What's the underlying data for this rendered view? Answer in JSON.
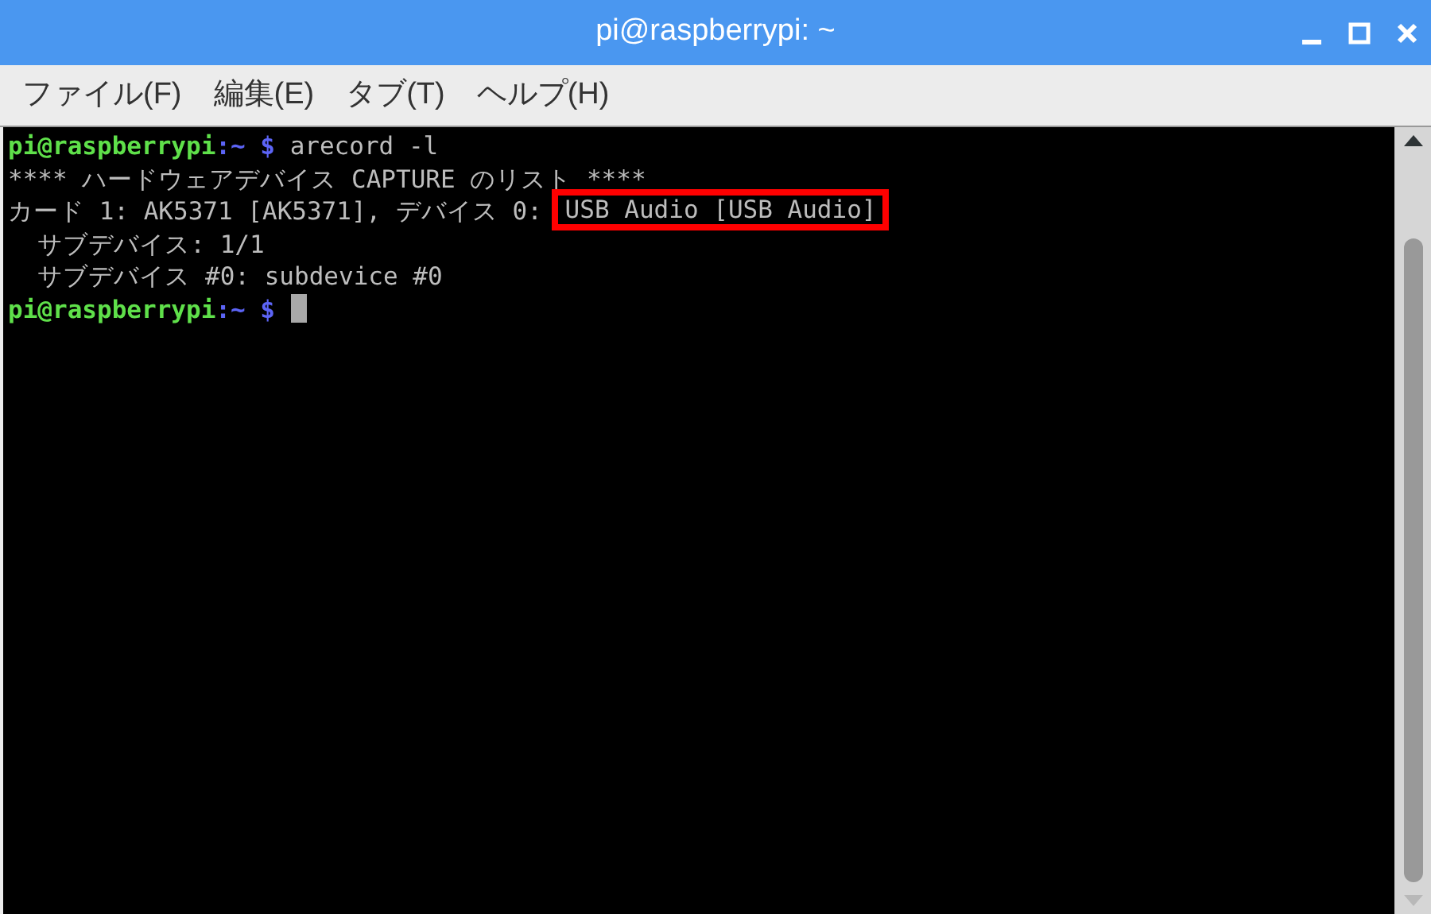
{
  "window": {
    "title": "pi@raspberrypi: ~"
  },
  "menu": [
    {
      "label": "ファイル(F)"
    },
    {
      "label": "編集(E)"
    },
    {
      "label": "タブ(T)"
    },
    {
      "label": "ヘルプ(H)"
    }
  ],
  "terminal": {
    "lines": [
      {
        "segments": [
          {
            "kind": "user",
            "text": "pi@raspberrypi"
          },
          {
            "kind": "path",
            "text": ":~ $"
          },
          {
            "kind": "output",
            "text": " arecord -l"
          }
        ]
      },
      {
        "segments": [
          {
            "kind": "output",
            "text": "**** ハードウェアデバイス CAPTURE のリスト ****"
          }
        ]
      },
      {
        "segments": [
          {
            "kind": "output",
            "text": "カード 1: AK5371 [AK5371], デバイス 0: "
          },
          {
            "kind": "output",
            "text": "USB Audio [USB Audio]",
            "highlighted": true
          }
        ]
      },
      {
        "segments": [
          {
            "kind": "output",
            "text": "  サブデバイス: 1/1"
          }
        ]
      },
      {
        "segments": [
          {
            "kind": "output",
            "text": "  サブデバイス #0: subdevice #0"
          }
        ]
      },
      {
        "segments": [
          {
            "kind": "user",
            "text": "pi@raspberrypi"
          },
          {
            "kind": "path",
            "text": ":~ $"
          },
          {
            "kind": "cursor"
          }
        ]
      }
    ]
  }
}
